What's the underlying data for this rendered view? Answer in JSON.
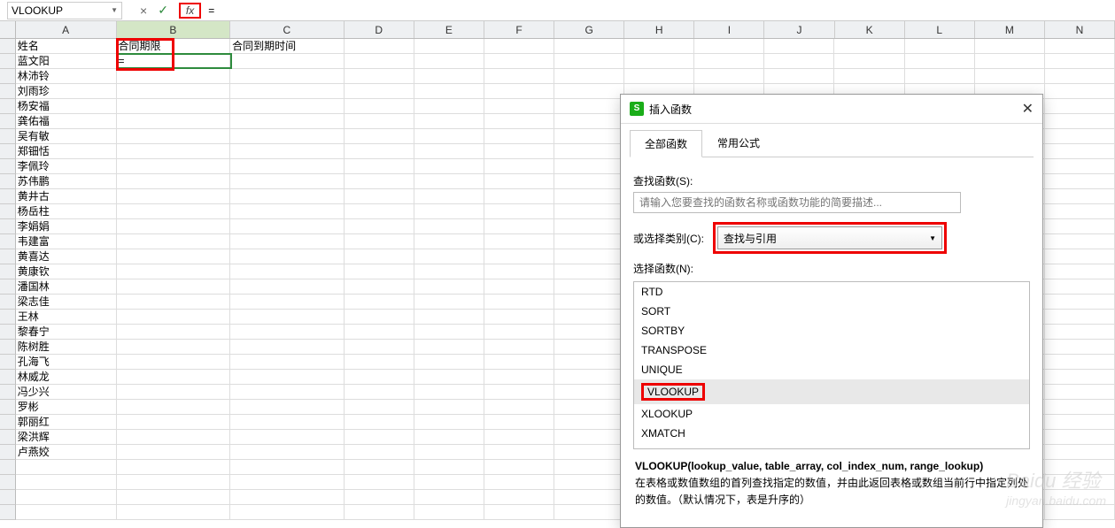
{
  "formula_bar": {
    "name_box": "VLOOKUP",
    "cancel_glyph": "×",
    "confirm_glyph": "✓",
    "fx_label": "fx",
    "formula_text": "="
  },
  "columns": [
    "A",
    "B",
    "C",
    "D",
    "E",
    "F",
    "G",
    "H",
    "I",
    "J",
    "K",
    "L",
    "M",
    "N"
  ],
  "active_col": "B",
  "headers": {
    "A": "姓名",
    "B": "合同期限",
    "C": "合同到期时间"
  },
  "active_cell_value": "=",
  "names": [
    "蓝文阳",
    "林沛铃",
    "刘雨珍",
    "杨安福",
    "龚佑福",
    "吴有敏",
    "郑钿恬",
    "李佩玲",
    "苏伟鹏",
    "黄井古",
    "杨岳柱",
    "李娟娟",
    "韦建富",
    "黄喜达",
    "黄康钦",
    "潘国林",
    "梁志佳",
    "王林",
    "黎春宁",
    "陈树胜",
    "孔海飞",
    "林威龙",
    "冯少兴",
    "罗彬",
    "郭丽红",
    "梁洪辉",
    "卢燕姣"
  ],
  "dialog": {
    "title": "插入函数",
    "logo": "S",
    "tabs": {
      "all": "全部函数",
      "common": "常用公式"
    },
    "search_label": "查找函数(S):",
    "search_placeholder": "请输入您要查找的函数名称或函数功能的简要描述...",
    "category_label": "或选择类别(C):",
    "category_value": "查找与引用",
    "select_label": "选择函数(N):",
    "functions": [
      "RTD",
      "SORT",
      "SORTBY",
      "TRANSPOSE",
      "UNIQUE",
      "VLOOKUP",
      "XLOOKUP",
      "XMATCH"
    ],
    "selected_fn": "VLOOKUP",
    "signature": "VLOOKUP(lookup_value, table_array, col_index_num, range_lookup)",
    "description": "在表格或数值数组的首列查找指定的数值，并由此返回表格或数组当前行中指定列处的数值。（默认情况下，表是升序的）"
  },
  "watermark": {
    "brand": "Baidu 经验",
    "url": "jingyan.baidu.com"
  }
}
